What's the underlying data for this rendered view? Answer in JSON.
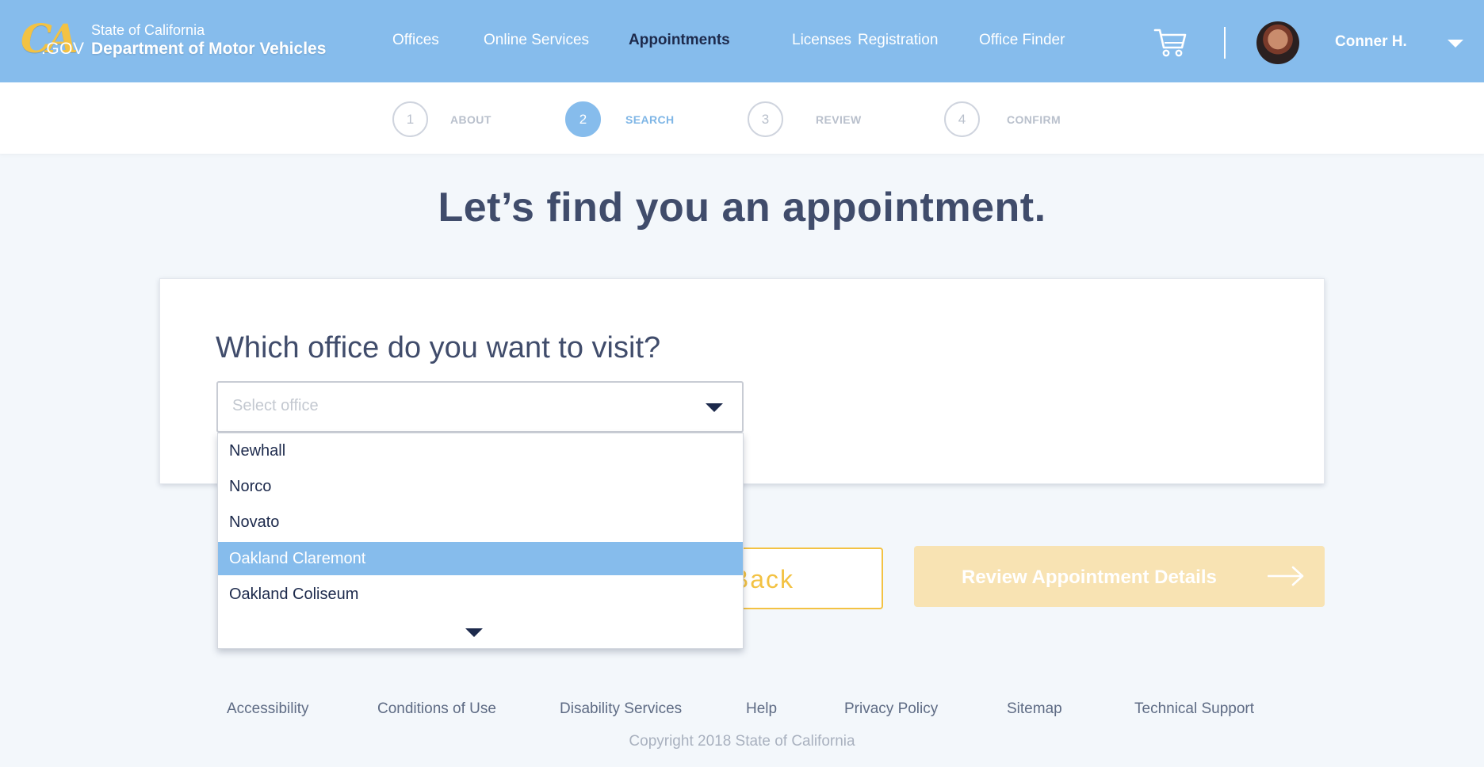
{
  "header": {
    "logo_ca": "CA",
    "logo_gov": ".GOV",
    "state": "State of California",
    "department": "Department of Motor Vehicles",
    "nav": [
      {
        "label": "Offices",
        "active": false
      },
      {
        "label": "Online Services",
        "active": false
      },
      {
        "label": "Appointments",
        "active": true
      },
      {
        "label": "Licenses",
        "active": false
      },
      {
        "label": "Registration",
        "active": false
      },
      {
        "label": "Office Finder",
        "active": false
      }
    ],
    "user_name": "Conner H.",
    "icons": {
      "cart": "shopping-cart-icon",
      "user_menu": "chevron-down-icon"
    }
  },
  "stepper": {
    "steps": [
      {
        "number": "1",
        "label": "ABOUT",
        "active": false
      },
      {
        "number": "2",
        "label": "SEARCH",
        "active": true
      },
      {
        "number": "3",
        "label": "REVIEW",
        "active": false
      },
      {
        "number": "4",
        "label": "CONFIRM",
        "active": false
      }
    ]
  },
  "main": {
    "title": "Let’s find you an appointment.",
    "question": "Which office do you want to visit?",
    "select_placeholder": "Select office",
    "options": [
      "Newhall",
      "Norco",
      "Novato",
      "Oakland Claremont",
      "Oakland Coliseum"
    ],
    "highlighted_option": "Oakland Claremont",
    "back_label": "Back",
    "review_label": "Review Appointment Details"
  },
  "footer": {
    "links": [
      "Accessibility",
      "Conditions of Use",
      "Disability Services",
      "Help",
      "Privacy Policy",
      "Sitemap",
      "Technical Support"
    ],
    "copyright": "Copyright 2018 State of California"
  },
  "colors": {
    "header_bg": "#86bcec",
    "active_nav": "#1d2a4c",
    "accent_yellow": "#f3c243",
    "review_button_bg": "#f8e3b3",
    "page_bg": "#f3f7fb"
  }
}
